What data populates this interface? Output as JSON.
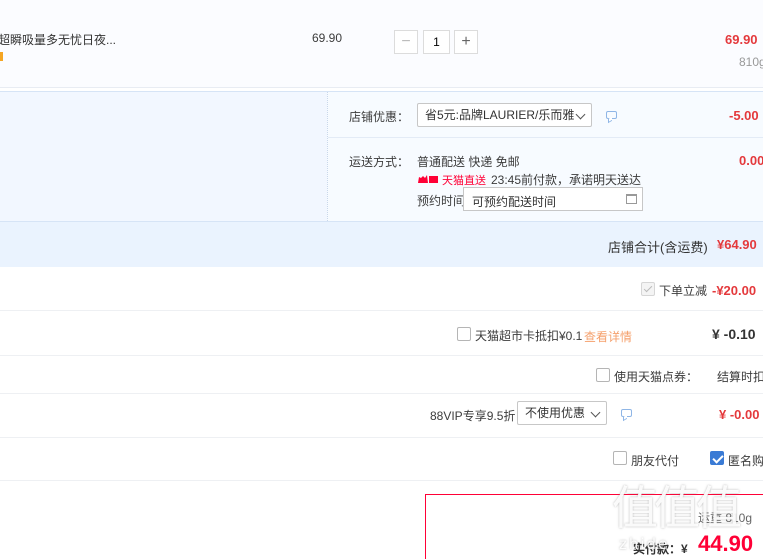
{
  "item": {
    "title": "超瞬吸量多无忧日夜...",
    "unit_price": "69.90",
    "quantity": "1",
    "minus_label": "−",
    "plus_label": "+",
    "subtotal": "69.90",
    "weight": "810g"
  },
  "shop": {
    "discount_label": "店铺优惠：",
    "discount_select": "省5元:品牌LAURIER/乐而雅",
    "discount_value": "-5.00",
    "shipping_label": "运送方式：",
    "shipping_method": "普通配送 快递 免邮",
    "tmall_direct_badge": "天猫直送",
    "delivery_promise": "23:45前付款，承诺明天送达",
    "reserve_label": "预约时间",
    "reserve_placeholder": "可预约配送时间",
    "shipping_value": "0.00",
    "total_label": "店铺合计(含运费)",
    "total_value": "¥64.90"
  },
  "order": {
    "instant_discount_label": "下单立减",
    "instant_discount_value": "-¥20.00",
    "supermarket_card_label": "天猫超市卡抵扣¥0.1",
    "supermarket_card_link": "查看详情",
    "supermarket_card_value": "¥ -0.10",
    "points_label": "使用天猫点券：",
    "points_value": "结算时扣除",
    "vip_label": "88VIP专享9.5折",
    "vip_select": "不使用优惠",
    "vip_value": "¥ -0.00",
    "friend_pay_label": "朋友代付",
    "anonymous_label": "匿名购买"
  },
  "summary": {
    "shipping_weight": "运重 810g",
    "paid_label": "实付款：¥",
    "paid_value": "44.90"
  },
  "watermark": {
    "logo": "值值值",
    "site": "zhide"
  },
  "colors": {
    "accent_red": "#ff0036",
    "price_red": "#e4393c",
    "checkbox_blue": "#3a7bd5"
  }
}
